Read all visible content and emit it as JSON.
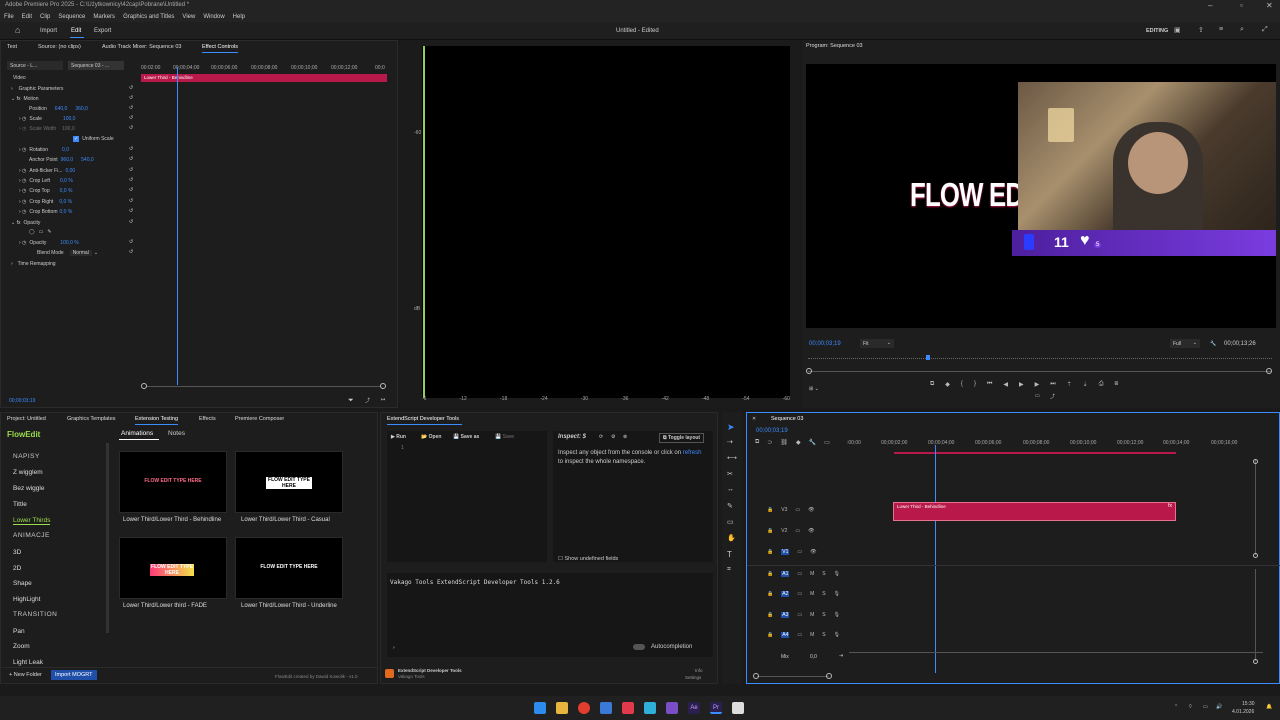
{
  "window": {
    "title": "Adobe Premiere Pro 2025 - C:\\Użytkownicy\\42cap\\Pobrane\\Untitled *"
  },
  "menu": [
    "File",
    "Edit",
    "Clip",
    "Sequence",
    "Markers",
    "Graphics and Titles",
    "View",
    "Window",
    "Help"
  ],
  "appbar": {
    "tabs": [
      "Import",
      "Edit",
      "Export"
    ],
    "doc_title": "Untitled - Edited",
    "workspace": "EDITING"
  },
  "source_tabs": [
    "Text",
    "Source: (no clips)",
    "Audio Track Mixer: Sequence 03",
    "Effect Controls"
  ],
  "effect_controls": {
    "source_label": "Source - L...",
    "seq_label": "Sequence 03 - ...",
    "clip_name": "Lower Third - Behindline",
    "ruler": [
      "00:02:00",
      "00;00;04;00",
      "00;00;06;00",
      "00;00;08;00",
      "00;00;10;00",
      "00;00;12;00",
      "00;0"
    ],
    "section_video": "Video",
    "rows": [
      {
        "label": "Graphic Parameters",
        "value": ""
      },
      {
        "label": "Motion",
        "value": ""
      },
      {
        "label": "Position",
        "value": "640,0",
        "value2": "360,0"
      },
      {
        "label": "Scale",
        "value": "100,0"
      },
      {
        "label": "Scale Width",
        "value": "100,0"
      },
      {
        "label": "Uniform Scale",
        "value": ""
      },
      {
        "label": "Rotation",
        "value": "0,0"
      },
      {
        "label": "Anchor Point",
        "value": "960,0",
        "value2": "540,0"
      },
      {
        "label": "Anti-flicker Fi...",
        "value": "0,00"
      },
      {
        "label": "Crop Left",
        "value": "0,0 %"
      },
      {
        "label": "Crop Top",
        "value": "0,0 %"
      },
      {
        "label": "Crop Right",
        "value": "0,0 %"
      },
      {
        "label": "Crop Bottom",
        "value": "0,0 %"
      },
      {
        "label": "Opacity",
        "value": ""
      },
      {
        "label": "Opacity",
        "value": "100,0 %"
      },
      {
        "label": "Blend Mode",
        "value": "Normal"
      },
      {
        "label": "Time Remapping",
        "value": ""
      }
    ],
    "timecode": "00;00;03;19"
  },
  "program": {
    "tab": "Program: Sequence 03",
    "timecode": "00;00;03;19",
    "fit": "Fit",
    "quality": "Full",
    "duration": "00;00;13;26",
    "title_text": "FLOW EDI",
    "badge_count": "11",
    "heart_count": "5"
  },
  "audio_meter": {
    "ticks": [
      "-6",
      "-12",
      "-18",
      "-24",
      "-30",
      "-36",
      "-42",
      "-48",
      "-54",
      "-60",
      "dB"
    ]
  },
  "left_panel_tabs": [
    "Project: Untitled",
    "Graphics Templates",
    "Extension Testing",
    "Effects",
    "Premiere Composer"
  ],
  "flowedit": {
    "logo": "FlowEdit",
    "tabs": [
      "Animations",
      "Notes"
    ],
    "categories": [
      {
        "type": "header",
        "label": "NAPISY"
      },
      {
        "type": "item",
        "label": "Z wigglem"
      },
      {
        "type": "item",
        "label": "Bez wiggle"
      },
      {
        "type": "item",
        "label": "Tittle"
      },
      {
        "type": "item",
        "label": "Lower Thirds",
        "active": true
      },
      {
        "type": "header",
        "label": "ANIMACJE"
      },
      {
        "type": "item",
        "label": "3D"
      },
      {
        "type": "item",
        "label": "2D"
      },
      {
        "type": "item",
        "label": "Shape"
      },
      {
        "type": "item",
        "label": "HighLight"
      },
      {
        "type": "header",
        "label": "TRANSITION"
      },
      {
        "type": "item",
        "label": "Pan"
      },
      {
        "type": "item",
        "label": "Zoom"
      },
      {
        "type": "item",
        "label": "Light Leak"
      }
    ],
    "templates": [
      {
        "name": "Lower Third/Lower Third - Behindline",
        "preview": "FLOW EDIT TYPE HERE",
        "preview_color": "#ff6b8a"
      },
      {
        "name": "Lower Third/Lower Third - Casual",
        "preview": "FLOW EDIT TYPE HERE",
        "preview_color": "#ffffff"
      },
      {
        "name": "Lower Third/Lower third - FADE",
        "preview": "FLOW EDIT TYPE HERE",
        "preview_color": "#f2e14a"
      },
      {
        "name": "Lower Third/Lower Third - Underline",
        "preview": "FLOW EDIT TYPE HERE",
        "preview_color": "#ffffff"
      }
    ],
    "new_folder": "+ New Folder",
    "import": "Import MOGRT",
    "credit": "FlowEdit created by Dawid Kowolik - v1.0"
  },
  "extendscript": {
    "tab": "ExtendScript Developer Tools",
    "buttons": [
      "Run",
      "Open",
      "Save as",
      "Save"
    ],
    "line_no": "1",
    "inspect_label": "Inspect: $",
    "toggle_layout": "Toggle layout",
    "inspect_text": "Inspect any object from the console or click on",
    "inspect_link": "refresh",
    "inspect_text2": " to inspect the whole namespace.",
    "show_undefined": "Show undefined fields",
    "console": "Vakago Tools ExtendScript Developer Tools 1.2.6",
    "autocompletion": "Autocompletion",
    "footer_title": "ExtendScript Developer Tools",
    "footer_sub": "Vakago Tools",
    "info": "Info",
    "settings": "Settings"
  },
  "timeline": {
    "tab": "Sequence 03",
    "timecode": "00;00;03;19",
    "ruler": [
      ":00;00",
      "00;00;02;00",
      "00;00;04;00",
      "00;00;06;00",
      "00;00;08;00",
      "00;00;10;00",
      "00;00;12;00",
      "00;00;14;00",
      "00;00;16;00"
    ],
    "tracks_v": [
      "V3",
      "V2",
      "V1"
    ],
    "tracks_a": [
      "A1",
      "A2",
      "A3",
      "A4"
    ],
    "mix_label": "Mix",
    "mix_value": "0,0",
    "clip": "Lower Third - Behindline"
  },
  "taskbar": {
    "time": "15:30",
    "date": "4.01.2026"
  },
  "colors": {
    "accent": "#2d8ceb",
    "clip": "#b8194a",
    "green": "#7bd14c"
  }
}
